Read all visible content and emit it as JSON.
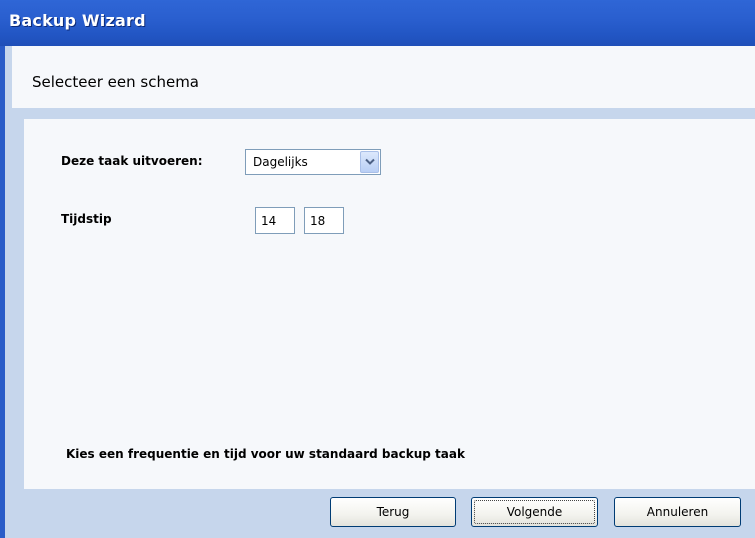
{
  "window": {
    "title": "Backup Wizard"
  },
  "header": {
    "heading": "Selecteer een schema"
  },
  "form": {
    "frequency_label": "Deze taak uitvoeren:",
    "frequency_value": "Dagelijks",
    "time_label": "Tijdstip",
    "time_hour": "14",
    "time_minute": "18",
    "hint": "Kies een frequentie en tijd voor uw standaard backup taak"
  },
  "buttons": {
    "back": "Terug",
    "next": "Volgende",
    "cancel": "Annuleren"
  },
  "icons": {
    "dropdown": "chevron-down-icon"
  },
  "colors": {
    "titlebar": "#2a5fcf",
    "client_background": "#c6d6ec",
    "panel_background": "#f6f8fb",
    "button_border": "#003c74"
  }
}
